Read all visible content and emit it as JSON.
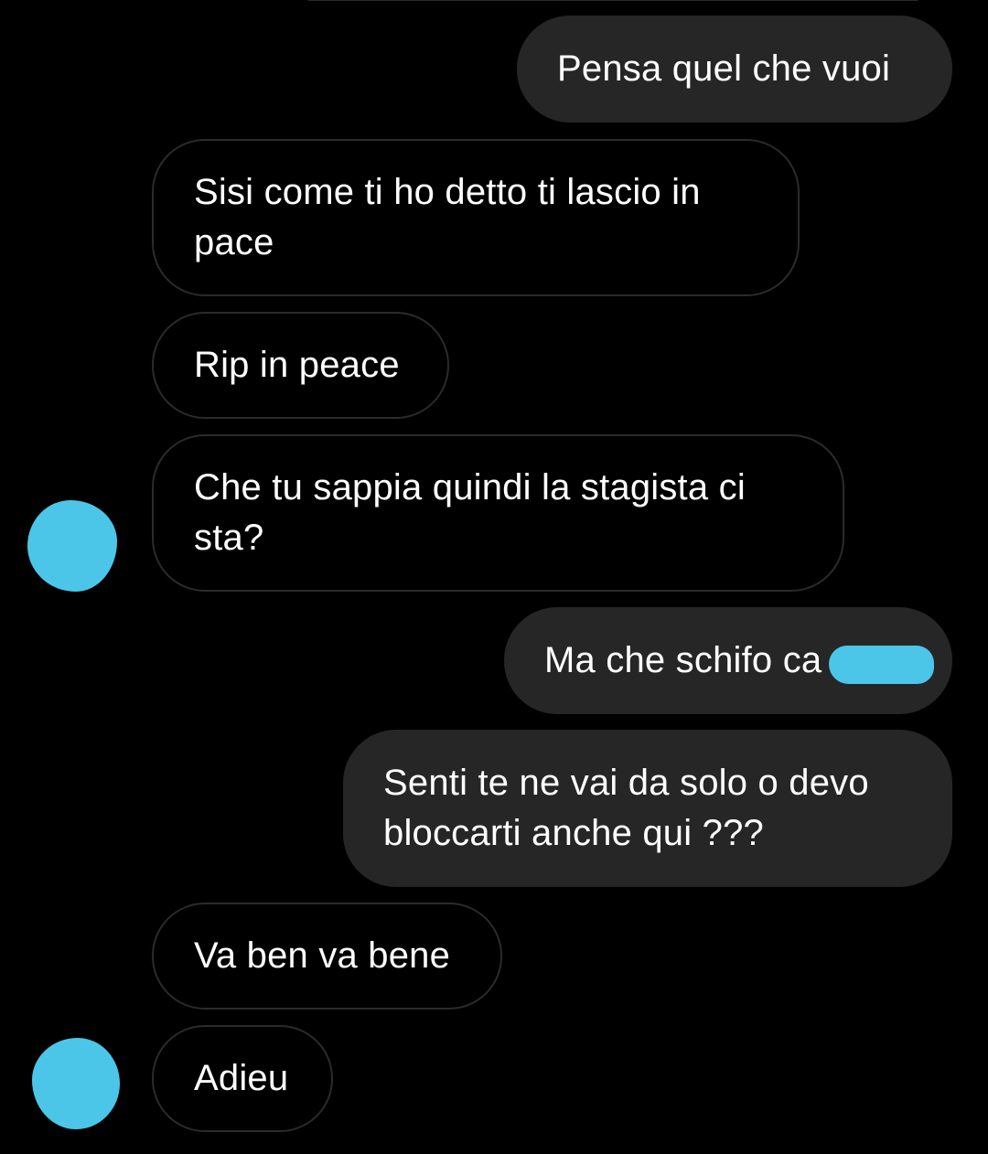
{
  "conversation": {
    "messages": [
      {
        "id": "m1",
        "direction": "outgoing",
        "text": "Pensa quel che vuoi"
      },
      {
        "id": "m2",
        "direction": "incoming",
        "text": "Sisi come ti ho detto ti lascio in\npace"
      },
      {
        "id": "m3",
        "direction": "incoming",
        "text": "Rip in peace"
      },
      {
        "id": "m4",
        "direction": "incoming",
        "text": "Che tu sappia quindi la stagista ci\nsta?"
      },
      {
        "id": "m5",
        "direction": "outgoing",
        "text": "Ma che schifo ca",
        "redacted_tail": true
      },
      {
        "id": "m6",
        "direction": "outgoing",
        "text": "Senti te ne vai da solo o devo\nbloccarti anche qui ???"
      },
      {
        "id": "m7",
        "direction": "incoming",
        "text": "Va ben va bene"
      },
      {
        "id": "m8",
        "direction": "incoming",
        "text": "Adieu"
      }
    ]
  },
  "colors": {
    "background": "#000000",
    "outgoing_bubble": "#262626",
    "incoming_border": "#2b2b2b",
    "redaction": "#4bc6e8",
    "text": "#ffffff"
  }
}
